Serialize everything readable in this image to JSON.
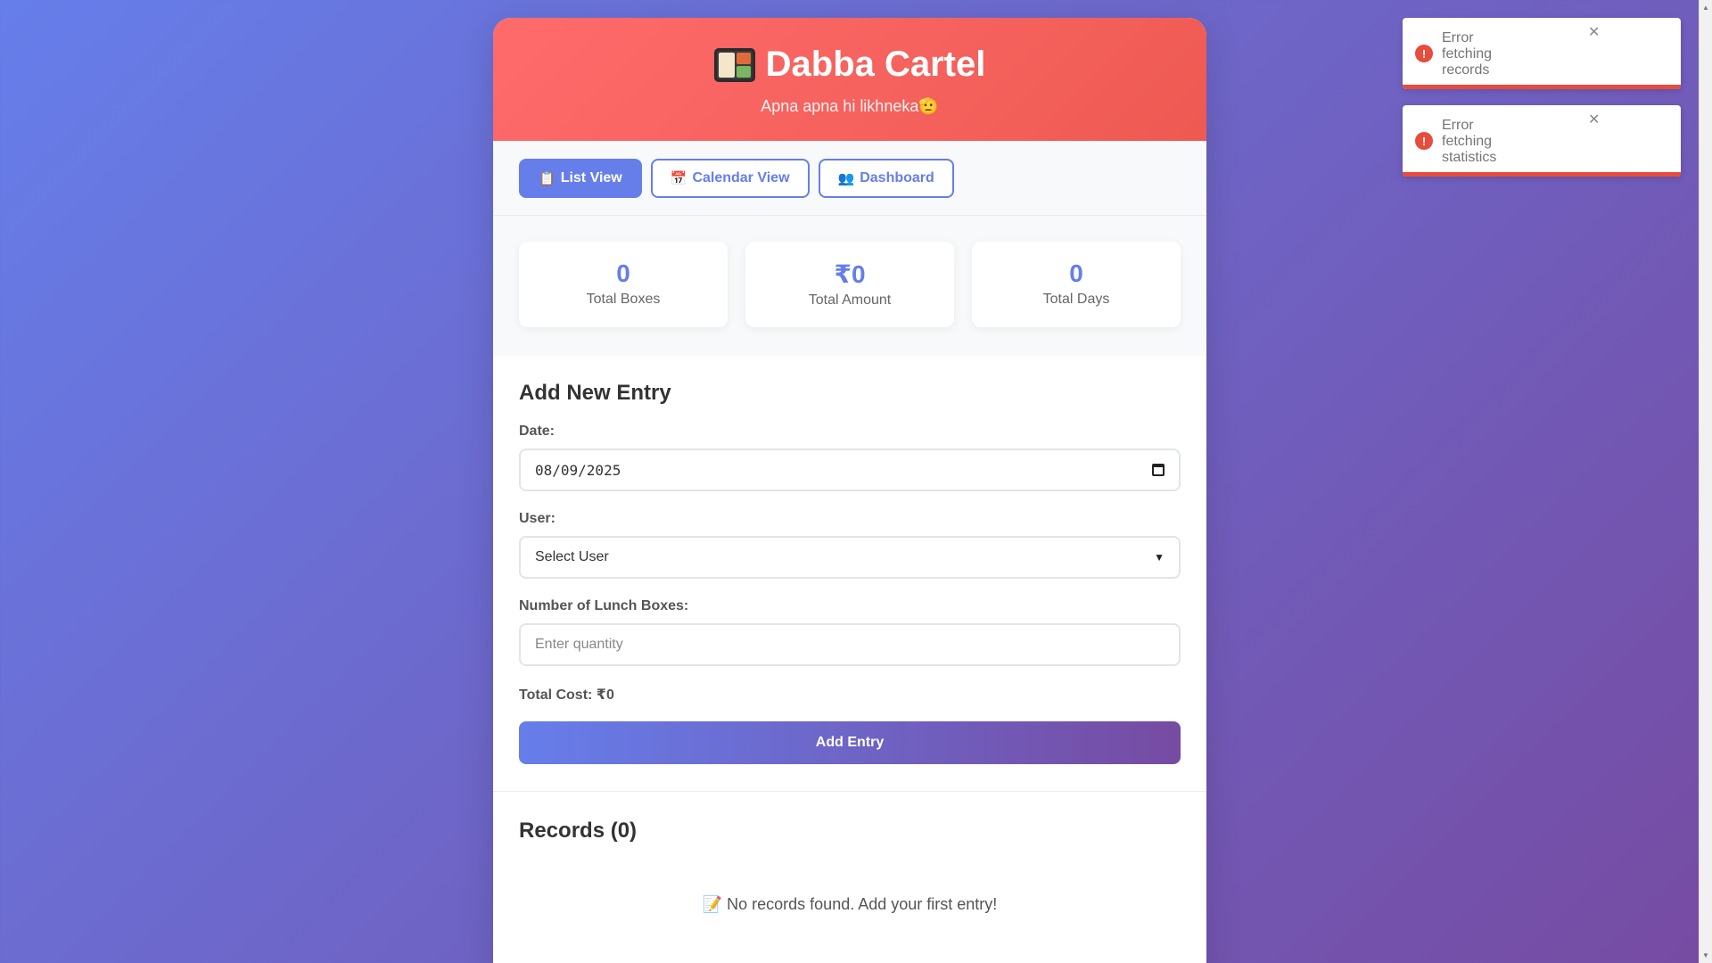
{
  "header": {
    "title": "Dabba Cartel",
    "subtitle": "Apna apna hi likhneka🫡",
    "logo_icon": "bento-box-icon"
  },
  "tabs": [
    {
      "label": "List View",
      "icon": "📋",
      "active": true
    },
    {
      "label": "Calendar View",
      "icon": "📅",
      "active": false
    },
    {
      "label": "Dashboard",
      "icon": "👥",
      "active": false
    }
  ],
  "stats": [
    {
      "value": "0",
      "label": "Total Boxes"
    },
    {
      "value": "₹0",
      "label": "Total Amount"
    },
    {
      "value": "0",
      "label": "Total Days"
    }
  ],
  "form": {
    "title": "Add New Entry",
    "date_label": "Date:",
    "date_value": "08/09/2025",
    "user_label": "User:",
    "user_value": "Select User",
    "qty_label": "Number of Lunch Boxes:",
    "qty_placeholder": "Enter quantity",
    "total_cost": "Total Cost: ₹0",
    "submit_label": "Add Entry"
  },
  "records": {
    "title": "Records (0)",
    "empty_icon": "📝",
    "empty_text": "No records found. Add your first entry!"
  },
  "toasts": [
    {
      "message": "Error fetching records",
      "close": "✕"
    },
    {
      "message": "Error fetching statistics",
      "close": "✕"
    }
  ],
  "colors": {
    "accent": "#667eea",
    "header": "#ff6b6b",
    "error": "#e74c3c"
  }
}
